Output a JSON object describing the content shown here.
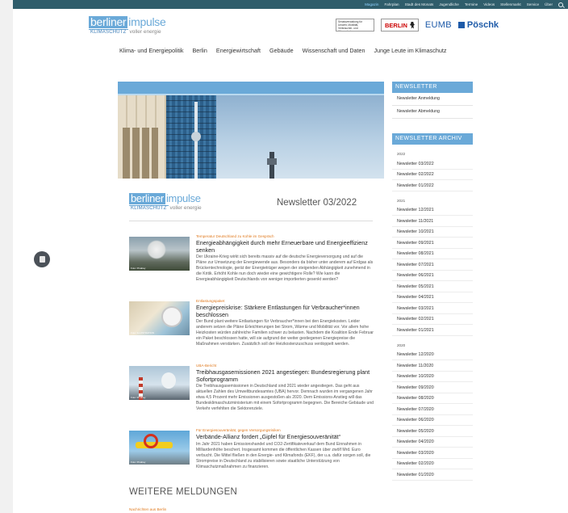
{
  "topbar": {
    "links": [
      "Magazin",
      "Fahrplan",
      "Stadt des Monats",
      "Jugendliche",
      "Termine",
      "Videos",
      "Stellenmarkt",
      "Service",
      "Über"
    ],
    "active_index": 0
  },
  "logo": {
    "part1": "berliner",
    "part2": "impulse",
    "sub1": "KLIMASCHUTZ",
    "sub2": "voller energie"
  },
  "partners": {
    "box_text": "Senatsverwaltung für Umwelt, Mobilität, Verbraucher- und Klimaschutz",
    "berlin": "BERLIN",
    "eumb": "EUMB",
    "poeschk": "Pöschk"
  },
  "mainnav": [
    "Klima- und Energiepolitik",
    "Berlin",
    "Energiewirtschaft",
    "Gebäude",
    "Wissenschaft und Daten",
    "Junge Leute im Klimaschutz"
  ],
  "newsletter": {
    "title": "Newsletter 03/2022"
  },
  "articles": [
    {
      "kicker": "Temperatur Deutschland zu Kohle im Gespräch",
      "headline": "Energieabhängigkeit durch mehr Erneuerbare und Energieeffizienz senken",
      "teaser": "Der Ukraine-Krieg wirkt sich bereits massiv auf die deutsche Energieversorgung und auf die Pläne zur Umsetzung der Energiewende aus. Besonders da bisher unter anderem auf Erdgas als Brückentechnologie, gerät der Energieträger wegen der steigenden Abhängigkeit zunehmend in die Kritik. Erhöht Kohle nun doch wieder eine gewichtigere Rolle? Wie kann die Energieabhängigkeit Deutschlands von weniger importierten gesenkt werden?",
      "credit": "Foto: Pixabay"
    },
    {
      "kicker": "Entlastungspaket",
      "headline": "Energiepreiskrise: Stärkere Entlastungen für Verbraucher*innen beschlossen",
      "teaser": "Der Bund plant weitere Entlastungen für Verbraucher*innen bei den Energiekosten. Leider anderem setzen die Pläne Erleichterungen bei Strom, Wärme und Mobilität vor. Vor allem hohe Heizkosten würden zahlreiche Familien schwer zu belasten. Nachdem die Koalition Ende Februar ein Paket beschlossen hatte, will sie aufgrund der weiter gestiegenen Energiepreise die Maßnahmen verstärken. Zusätzlich soll der Heizkostenzuschuss verdoppelt werden.",
      "credit": "Foto: ILLUSTRATION"
    },
    {
      "kicker": "UBA-Bericht",
      "headline": "Treibhausgasemissionen 2021 angestiegen: Bundesregierung plant Sofortprogramm",
      "teaser": "Die Treibhausgasemissionen in Deutschland sind 2021 wieder angestiegen. Das geht aus aktuellen Zahlen des Umweltbundesamtes (UBA) hervor. Demnach wurden im vergangenen Jahr etwa 4,5 Prozent mehr Emissionen ausgestoßen als 2020. Dem Emissions-Anstieg will das Bundesklimaschutzministerium mit einem Sofortprogramm begegnen. Die Bereiche Gebäude und Verkehr verfehlten die Sektorenziele.",
      "credit": "Foto: Pixabay"
    },
    {
      "kicker": "Für Energiesouveränität, gegen Versorgungsrisiken",
      "headline": "Verbände-Allianz fordert „Gipfel für Energiesouveränität“",
      "teaser": "Im Jahr 2021 haben Emissionshandel und CO2-Zertifikateverkauf dem Bund Einnahmen in Milliardenhöhe beschert. Insgesamt kommen die öffentlichen Kassen über zwölf Mrd. Euro verbucht. Die Mittel fließen in den Energie- und Klimafonds (EKF), der u.a. dafür sorgen soll, die Strompreise in Deutschland zu stabilisieren sowie staatliche Unterstützung von Klimaschutzmaßnahmen zu finanzieren.",
      "credit": "Foto: Pixabay"
    }
  ],
  "more": {
    "title": "WEITERE MELDUNGEN",
    "kicker": "Nachrichten aus Berlin"
  },
  "sidebar": {
    "newsletter_heading": "NEWSLETTER",
    "items": [
      "Newsletter Anmeldung",
      "Newsletter Abmeldung"
    ],
    "archive_heading": "NEWSLETTER ARCHIV",
    "years": [
      {
        "year": "2022",
        "links": [
          "Newsletter 03/2022",
          "Newsletter 02/2022",
          "Newsletter 01/2022"
        ]
      },
      {
        "year": "2021",
        "links": [
          "Newsletter 12/2021",
          "Newsletter 11/2021",
          "Newsletter 10/2021",
          "Newsletter 09/2021",
          "Newsletter 08/2021",
          "Newsletter 07/2021",
          "Newsletter 06/2021",
          "Newsletter 05/2021",
          "Newsletter 04/2021",
          "Newsletter 03/2021",
          "Newsletter 02/2021",
          "Newsletter 01/2021"
        ]
      },
      {
        "year": "2020",
        "links": [
          "Newsletter 12/2020",
          "Newsletter 11/2020",
          "Newsletter 10/2020",
          "Newsletter 09/2020",
          "Newsletter 08/2020",
          "Newsletter 07/2020",
          "Newsletter 06/2020",
          "Newsletter 05/2020",
          "Newsletter 04/2020",
          "Newsletter 03/2020",
          "Newsletter 02/2020",
          "Newsletter 01/2020"
        ]
      }
    ]
  },
  "colors": {
    "accent": "#6aa9d8",
    "topbar": "#2f5d6b",
    "kicker": "#e07a1f",
    "brand_blue": "#1d5aa8"
  },
  "icons": [
    "search-icon",
    "bear-icon",
    "chat-icon"
  ]
}
